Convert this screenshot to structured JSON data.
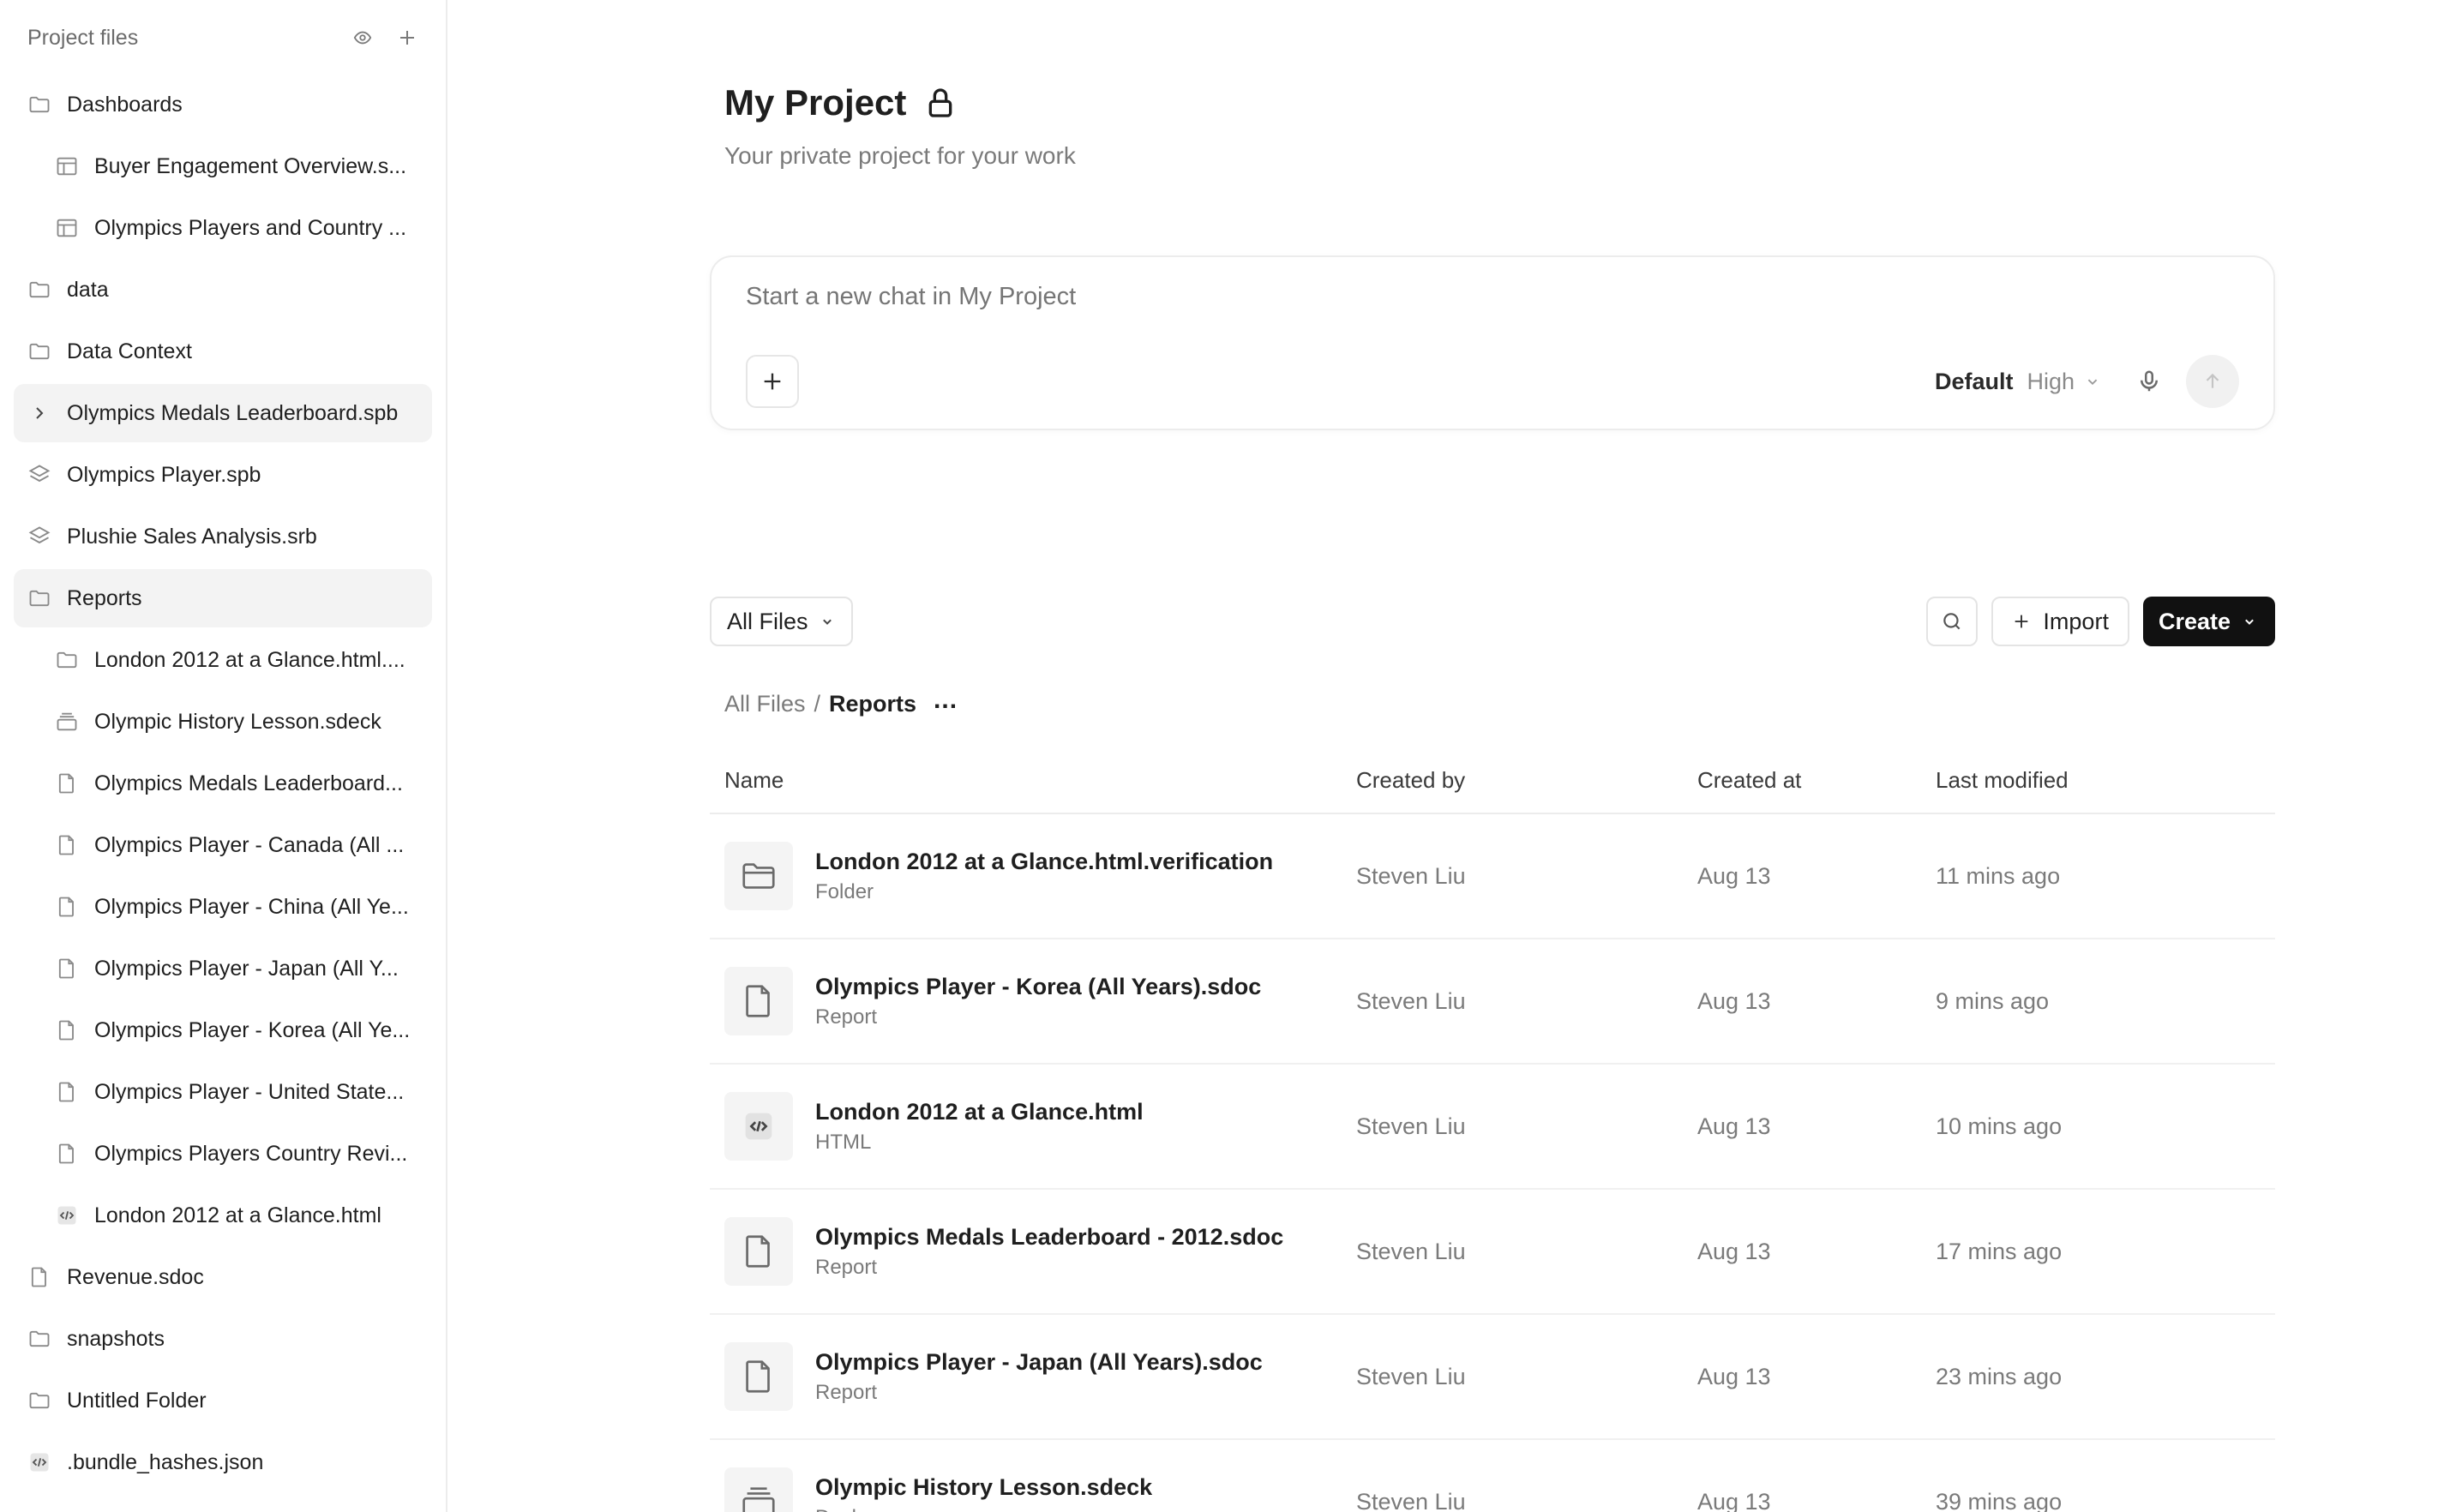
{
  "sidebar": {
    "title": "Project files",
    "items": [
      {
        "label": "Dashboards",
        "icon": "folder-icon",
        "child": false,
        "active": false
      },
      {
        "label": "Buyer Engagement Overview.s...",
        "icon": "dashboard-icon",
        "child": true,
        "active": false
      },
      {
        "label": "Olympics Players and Country ...",
        "icon": "dashboard-icon",
        "child": true,
        "active": false
      },
      {
        "label": "data",
        "icon": "folder-icon",
        "child": false,
        "active": false
      },
      {
        "label": "Data Context",
        "icon": "folder-icon",
        "child": false,
        "active": false
      },
      {
        "label": "Olympics Medals Leaderboard.spb",
        "icon": "chevron-right-icon",
        "child": false,
        "active": true
      },
      {
        "label": "Olympics Player.spb",
        "icon": "layers-icon",
        "child": false,
        "active": false
      },
      {
        "label": "Plushie Sales Analysis.srb",
        "icon": "layers-icon",
        "child": false,
        "active": false
      },
      {
        "label": "Reports",
        "icon": "folder-icon",
        "child": false,
        "active": true
      },
      {
        "label": "London 2012 at a Glance.html....",
        "icon": "folder-icon",
        "child": true,
        "active": false
      },
      {
        "label": "Olympic History Lesson.sdeck",
        "icon": "deck-icon",
        "child": true,
        "active": false
      },
      {
        "label": "Olympics Medals Leaderboard...",
        "icon": "file-icon",
        "child": true,
        "active": false
      },
      {
        "label": "Olympics Player - Canada (All ...",
        "icon": "file-icon",
        "child": true,
        "active": false
      },
      {
        "label": "Olympics Player - China (All Ye...",
        "icon": "file-icon",
        "child": true,
        "active": false
      },
      {
        "label": "Olympics Player - Japan (All Y...",
        "icon": "file-icon",
        "child": true,
        "active": false
      },
      {
        "label": "Olympics Player - Korea (All Ye...",
        "icon": "file-icon",
        "child": true,
        "active": false
      },
      {
        "label": "Olympics Player - United State...",
        "icon": "file-icon",
        "child": true,
        "active": false
      },
      {
        "label": "Olympics Players Country Revi...",
        "icon": "file-icon",
        "child": true,
        "active": false
      },
      {
        "label": "London 2012 at a Glance.html",
        "icon": "code-icon",
        "child": true,
        "active": false
      },
      {
        "label": "Revenue.sdoc",
        "icon": "file-icon",
        "child": false,
        "active": false
      },
      {
        "label": "snapshots",
        "icon": "folder-icon",
        "child": false,
        "active": false
      },
      {
        "label": "Untitled Folder",
        "icon": "folder-icon",
        "child": false,
        "active": false
      },
      {
        "label": ".bundle_hashes.json",
        "icon": "code-icon",
        "child": false,
        "active": false
      }
    ]
  },
  "project": {
    "title": "My Project",
    "subtitle": "Your private project for your work"
  },
  "chat": {
    "placeholder": "Start a new chat in My Project",
    "model_default": "Default",
    "model_level": "High"
  },
  "toolbar": {
    "filter_label": "All Files",
    "import_label": "Import",
    "create_label": "Create"
  },
  "breadcrumb": {
    "root": "All Files",
    "separator": "/",
    "current": "Reports",
    "more": "..."
  },
  "table": {
    "headers": {
      "name": "Name",
      "created_by": "Created by",
      "created_at": "Created at",
      "last_modified": "Last modified"
    },
    "rows": [
      {
        "name": "London 2012 at a Glance.html.verification",
        "type": "Folder",
        "icon": "folder-icon",
        "created_by": "Steven Liu",
        "created_at": "Aug 13",
        "last_modified": "11 mins ago"
      },
      {
        "name": "Olympics Player - Korea (All Years).sdoc",
        "type": "Report",
        "icon": "file-icon",
        "created_by": "Steven Liu",
        "created_at": "Aug 13",
        "last_modified": "9 mins ago"
      },
      {
        "name": "London 2012 at a Glance.html",
        "type": "HTML",
        "icon": "code-icon",
        "created_by": "Steven Liu",
        "created_at": "Aug 13",
        "last_modified": "10 mins ago"
      },
      {
        "name": "Olympics Medals Leaderboard - 2012.sdoc",
        "type": "Report",
        "icon": "file-icon",
        "created_by": "Steven Liu",
        "created_at": "Aug 13",
        "last_modified": "17 mins ago"
      },
      {
        "name": "Olympics Player - Japan (All Years).sdoc",
        "type": "Report",
        "icon": "file-icon",
        "created_by": "Steven Liu",
        "created_at": "Aug 13",
        "last_modified": "23 mins ago"
      },
      {
        "name": "Olympic History Lesson.sdeck",
        "type": "Deck",
        "icon": "deck-icon",
        "created_by": "Steven Liu",
        "created_at": "Aug 13",
        "last_modified": "39 mins ago"
      }
    ]
  },
  "colors": {
    "accent": "#111111",
    "sidebar_active": "#f3f3f3",
    "muted_text": "#7a7a7a"
  }
}
